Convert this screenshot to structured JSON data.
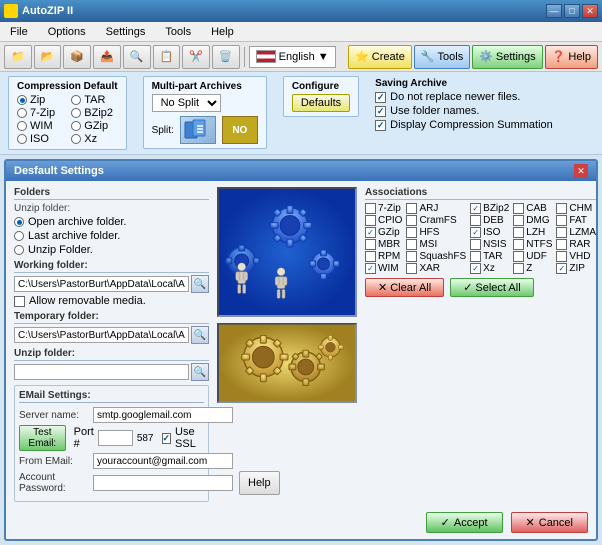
{
  "titleBar": {
    "title": "AutoZIP II",
    "icon": "⚡",
    "controls": [
      "—",
      "□",
      "✕"
    ]
  },
  "menuBar": {
    "items": [
      "File",
      "Options",
      "Settings",
      "Tools",
      "Help"
    ]
  },
  "toolbar": {
    "buttons": [
      "📁",
      "💾",
      "📦",
      "🔧",
      "🌐"
    ],
    "langLabel": "English",
    "rightButtons": [
      "Create",
      "Tools",
      "Settings",
      "Help"
    ]
  },
  "compressionDefault": {
    "title": "Compression Default",
    "options": [
      {
        "label": "Zip",
        "checked": true
      },
      {
        "label": "TAR",
        "checked": false
      },
      {
        "label": "7-Zip",
        "checked": false
      },
      {
        "label": "BZip2",
        "checked": false
      },
      {
        "label": "WIM",
        "checked": false
      },
      {
        "label": "GZip",
        "checked": false
      },
      {
        "label": "ISO",
        "checked": false
      },
      {
        "label": "Xz",
        "checked": false
      }
    ]
  },
  "multipart": {
    "title": "Multi-part Archives",
    "splitLabel": "Split:",
    "selectValue": "No Split"
  },
  "configure": {
    "title": "Configure",
    "defaultsLabel": "Defaults"
  },
  "savingArchive": {
    "title": "Saving Archive",
    "options": [
      {
        "label": "Do not replace newer files.",
        "checked": true
      },
      {
        "label": "Use folder names.",
        "checked": true
      },
      {
        "label": "Display Compression Summation",
        "checked": true
      }
    ]
  },
  "dialog": {
    "title": "Desfault Settings",
    "folders": {
      "title": "Folders",
      "unzipLabel": "Unzip folder:",
      "openArchiveLabel": "Open archive folder.",
      "openArchiveChecked": true,
      "lastArchiveLabel": "Last archive folder.",
      "lastArchiveChecked": false,
      "unzipFolderLabel": "Unzip Folder.",
      "unzipFolderChecked": false
    },
    "workingFolder": {
      "title": "Working folder:",
      "path": "C:\\Users\\PastorBurt\\AppData\\Local\\A..."
    },
    "allowRemovable": {
      "label": "Allow removable media.",
      "checked": false
    },
    "tempFolder": {
      "title": "Temporary folder:",
      "path": "C:\\Users\\PastorBurt\\AppData\\Local\\A..."
    },
    "unzipFolder": {
      "title": "Unzip folder:"
    },
    "associations": {
      "title": "Associations",
      "items": [
        {
          "label": "7-Zip",
          "checked": false
        },
        {
          "label": "ARJ",
          "checked": false
        },
        {
          "label": "BZip2",
          "checked": true
        },
        {
          "label": "CAB",
          "checked": false
        },
        {
          "label": "CHM",
          "checked": false
        },
        {
          "label": "CPIO",
          "checked": false
        },
        {
          "label": "CramFS",
          "checked": false
        },
        {
          "label": "DEB",
          "checked": false
        },
        {
          "label": "DMG",
          "checked": false
        },
        {
          "label": "FAT",
          "checked": false
        },
        {
          "label": "GZip",
          "checked": true
        },
        {
          "label": "HFS",
          "checked": false
        },
        {
          "label": "ISO",
          "checked": true
        },
        {
          "label": "LZH",
          "checked": false
        },
        {
          "label": "LZMA",
          "checked": false
        },
        {
          "label": "MBR",
          "checked": false
        },
        {
          "label": "MSI",
          "checked": false
        },
        {
          "label": "NSIS",
          "checked": false
        },
        {
          "label": "NTFS",
          "checked": false
        },
        {
          "label": "RAR",
          "checked": false
        },
        {
          "label": "RPM",
          "checked": false
        },
        {
          "label": "SquashFS",
          "checked": false
        },
        {
          "label": "TAR",
          "checked": false
        },
        {
          "label": "UDF",
          "checked": false
        },
        {
          "label": "VHD",
          "checked": false
        },
        {
          "label": "WIM",
          "checked": true
        },
        {
          "label": "XAR",
          "checked": false
        },
        {
          "label": "Xz",
          "checked": true
        },
        {
          "label": "Z",
          "checked": false
        },
        {
          "label": "ZIP",
          "checked": true
        }
      ],
      "clearAll": "Clear All",
      "selectAll": "Select All"
    },
    "email": {
      "title": "EMail Settings:",
      "serverName": "Server name:",
      "serverValue": "smtp.googlemail.com",
      "testEmailLabel": "Test Email:",
      "portLabel": "Port #",
      "portValue": "587",
      "useSslLabel": "Use SSL",
      "useSslChecked": true,
      "fromEmailLabel": "From EMail:",
      "fromEmailValue": "youraccount@gmail.com",
      "accountPasswordLabel": "Account Password:",
      "accountPasswordValue": "",
      "helpLabel": "Help"
    },
    "footer": {
      "acceptLabel": "Accept",
      "cancelLabel": "Cancel"
    }
  }
}
